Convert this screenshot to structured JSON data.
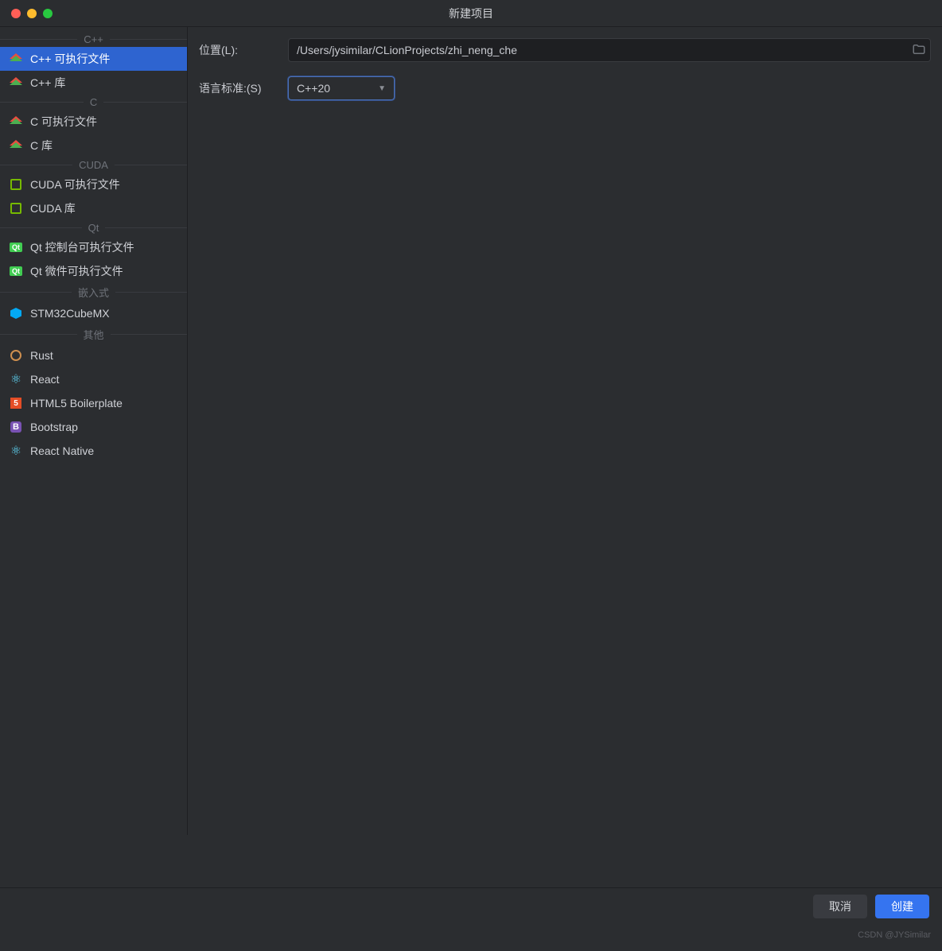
{
  "window": {
    "title": "新建项目"
  },
  "sidebar": {
    "cats": [
      "C++",
      "C",
      "CUDA",
      "Qt",
      "嵌入式",
      "其他"
    ],
    "items": {
      "cpp_exe": "C++ 可执行文件",
      "cpp_lib": "C++ 库",
      "c_exe": "C 可执行文件",
      "c_lib": "C 库",
      "cuda_exe": "CUDA 可执行文件",
      "cuda_lib": "CUDA 库",
      "qt_console": "Qt 控制台可执行文件",
      "qt_widget": "Qt 微件可执行文件",
      "stm32": "STM32CubeMX",
      "rust": "Rust",
      "react": "React",
      "html5": "HTML5 Boilerplate",
      "bootstrap": "Bootstrap",
      "rn": "React Native"
    }
  },
  "form": {
    "location_label": "位置(L):",
    "location_value": "/Users/jysimilar/CLionProjects/zhi_neng_che",
    "standard_label": "语言标准:(S)",
    "standard_value": "C++20"
  },
  "footer": {
    "cancel": "取消",
    "create": "创建"
  },
  "watermark": "CSDN @JYSimilar"
}
